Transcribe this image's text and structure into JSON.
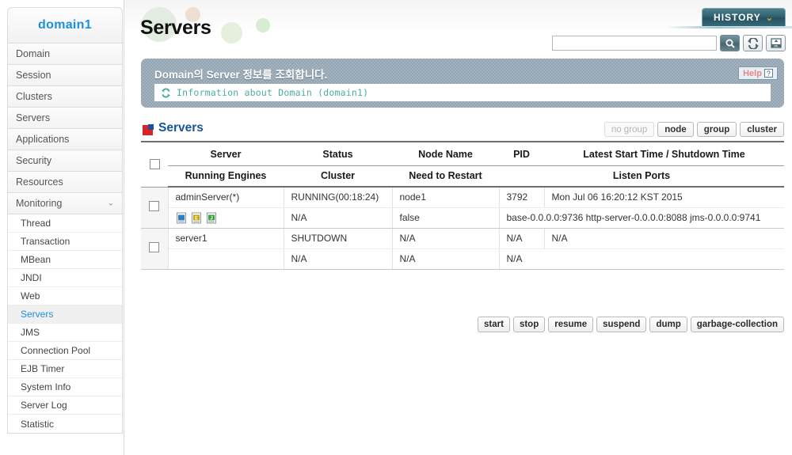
{
  "sidebar": {
    "logo": "domain1",
    "items": [
      {
        "label": "Domain",
        "chevron": ""
      },
      {
        "label": "Session",
        "chevron": ""
      },
      {
        "label": "Clusters",
        "chevron": ""
      },
      {
        "label": "Servers",
        "chevron": ""
      },
      {
        "label": "Applications",
        "chevron": ""
      },
      {
        "label": "Security",
        "chevron": ""
      },
      {
        "label": "Resources",
        "chevron": ""
      },
      {
        "label": "Monitoring",
        "chevron": "⌄"
      }
    ],
    "sub_items": [
      {
        "label": "Thread",
        "active": false
      },
      {
        "label": "Transaction",
        "active": false
      },
      {
        "label": "MBean",
        "active": false
      },
      {
        "label": "JNDI",
        "active": false
      },
      {
        "label": "Web",
        "active": false
      },
      {
        "label": "Servers",
        "active": true
      },
      {
        "label": "JMS",
        "active": false
      },
      {
        "label": "Connection Pool",
        "active": false
      },
      {
        "label": "EJB Timer",
        "active": false
      },
      {
        "label": "System Info",
        "active": false
      },
      {
        "label": "Server Log",
        "active": false
      },
      {
        "label": "Statistic",
        "active": false
      }
    ]
  },
  "header": {
    "title": "Servers",
    "history_label": "HISTORY",
    "history_chevron": "⌄",
    "search_value": "",
    "search_placeholder": "",
    "icons": [
      "search-icon",
      "refresh-icon",
      "xml-export-icon"
    ]
  },
  "banner": {
    "title": "Domain의 Server 정보를 조회합니다.",
    "info": "Information about Domain (domain1)",
    "help_label": "Help",
    "help_mark": "?"
  },
  "section": {
    "title": "Servers",
    "group_buttons": [
      {
        "label": "no group",
        "disabled": true
      },
      {
        "label": "node",
        "disabled": false
      },
      {
        "label": "group",
        "disabled": false
      },
      {
        "label": "cluster",
        "disabled": false
      }
    ]
  },
  "table": {
    "headers_row1": [
      "Server",
      "Status",
      "Node Name",
      "PID",
      "Latest Start Time / Shutdown Time"
    ],
    "headers_row2": [
      "Running Engines",
      "Cluster",
      "Need to Restart",
      "Listen Ports"
    ],
    "rows": [
      {
        "server": "adminServer(*)",
        "status": "RUNNING(00:18:24)",
        "node_name": "node1",
        "pid": "3792",
        "latest_time": "Mon Jul 06 16:20:12 KST 2015",
        "engines": [
          "engine-icon-web",
          "engine-icon-ejb",
          "engine-icon-jms"
        ],
        "cluster": "N/A",
        "need_restart": "false",
        "listen_ports": "base-0.0.0.0:9736  http-server-0.0.0.0:8088  jms-0.0.0.0:9741"
      },
      {
        "server": "server1",
        "status": "SHUTDOWN",
        "node_name": "N/A",
        "pid": "N/A",
        "latest_time": "N/A",
        "engines": [],
        "cluster": "N/A",
        "need_restart": "N/A",
        "listen_ports": "N/A"
      }
    ]
  },
  "actions": [
    {
      "label": "start"
    },
    {
      "label": "stop"
    },
    {
      "label": "resume"
    },
    {
      "label": "suspend"
    },
    {
      "label": "dump"
    },
    {
      "label": "garbage-collection"
    }
  ],
  "colors": {
    "accent_blue": "#1b8fe0",
    "section_blue": "#19549c",
    "banner_gray": "#93a5b2",
    "history_teal": "#2e5f6e",
    "chevron_orange": "#f0a11e",
    "info_teal": "#4aada3",
    "help_salmon": "#e08a8a",
    "icon_red": "#d8232a"
  }
}
